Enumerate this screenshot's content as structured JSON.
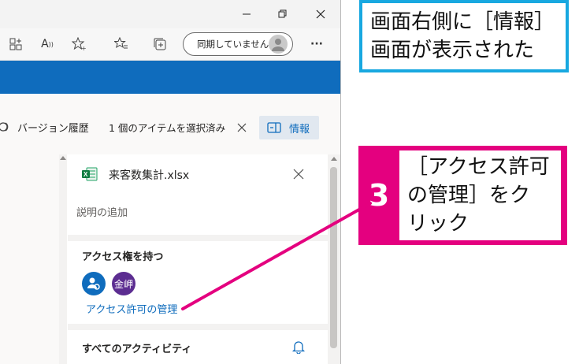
{
  "browser": {
    "sync_label": "同期していません",
    "more_label": "···"
  },
  "command_bar": {
    "version_history": "バージョン履歴",
    "selection_count": "1 個のアイテムを選択済み",
    "info_label": "情報"
  },
  "details_panel": {
    "file_name": "来客数集計.xlsx",
    "description_placeholder": "説明の追加",
    "access_heading": "アクセス権を持つ",
    "avatar_person_label": "金岬",
    "manage_access_link": "アクセス許可の管理",
    "activity_heading": "すべてのアクティビティ"
  },
  "colors": {
    "accent_blue": "#0f6cbd",
    "callout_magenta": "#e4007f",
    "callout_cyan": "#18a8e0"
  },
  "annotations": {
    "callout1_text": "画面右側に［情報］\n画面が表示された",
    "callout2_number": "3",
    "callout2_text": "［アクセス許可\nの管理］をク\nリック"
  }
}
